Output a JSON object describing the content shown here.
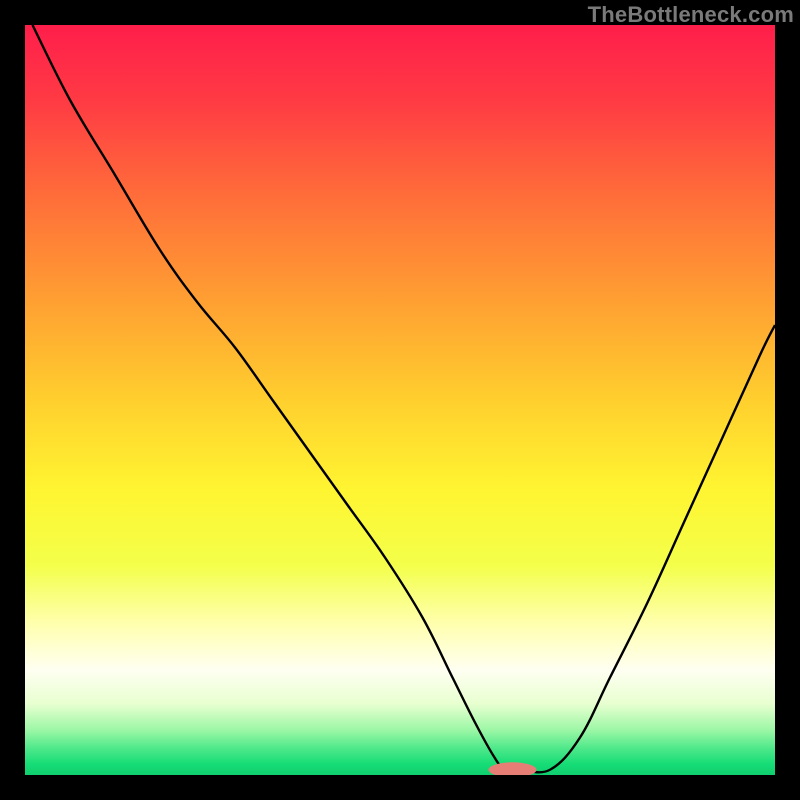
{
  "watermark": "TheBottleneck.com",
  "colors": {
    "black": "#000000",
    "curve": "#000000",
    "marker_fill": "#e77e76",
    "marker_stroke": "#c95a54",
    "gradient_stops": [
      {
        "offset": 0.0,
        "color": "#ff1e4b"
      },
      {
        "offset": 0.1,
        "color": "#ff3a44"
      },
      {
        "offset": 0.22,
        "color": "#ff6a3a"
      },
      {
        "offset": 0.35,
        "color": "#ff9933"
      },
      {
        "offset": 0.5,
        "color": "#ffcf2e"
      },
      {
        "offset": 0.62,
        "color": "#fff531"
      },
      {
        "offset": 0.72,
        "color": "#f3ff4a"
      },
      {
        "offset": 0.8,
        "color": "#ffffb0"
      },
      {
        "offset": 0.86,
        "color": "#fffff2"
      },
      {
        "offset": 0.905,
        "color": "#e8ffd0"
      },
      {
        "offset": 0.94,
        "color": "#9cf7a6"
      },
      {
        "offset": 0.965,
        "color": "#4de88a"
      },
      {
        "offset": 0.985,
        "color": "#17dd76"
      },
      {
        "offset": 1.0,
        "color": "#0fce6e"
      }
    ]
  },
  "chart_data": {
    "type": "line",
    "title": "",
    "xlabel": "",
    "ylabel": "",
    "xlim": [
      0,
      100
    ],
    "ylim": [
      0,
      100
    ],
    "x": [
      1,
      6,
      12,
      18,
      23,
      28,
      33,
      38,
      43,
      48,
      53,
      57,
      60,
      62.5,
      64,
      66,
      70,
      74,
      78,
      83,
      88,
      93,
      98,
      100
    ],
    "values": [
      100,
      90,
      80,
      70,
      63,
      57,
      50,
      43,
      36,
      29,
      21,
      13,
      7,
      2.5,
      0.7,
      0.7,
      0.7,
      5,
      13,
      23,
      34,
      45,
      56,
      60
    ],
    "marker": {
      "x_center": 65,
      "y": 0.7,
      "rx": 3.2,
      "ry": 1.0
    },
    "note": "y is bottleneck percentage; 0 at bottom (green), 100 at top (red). Values estimated from pixel positions."
  }
}
